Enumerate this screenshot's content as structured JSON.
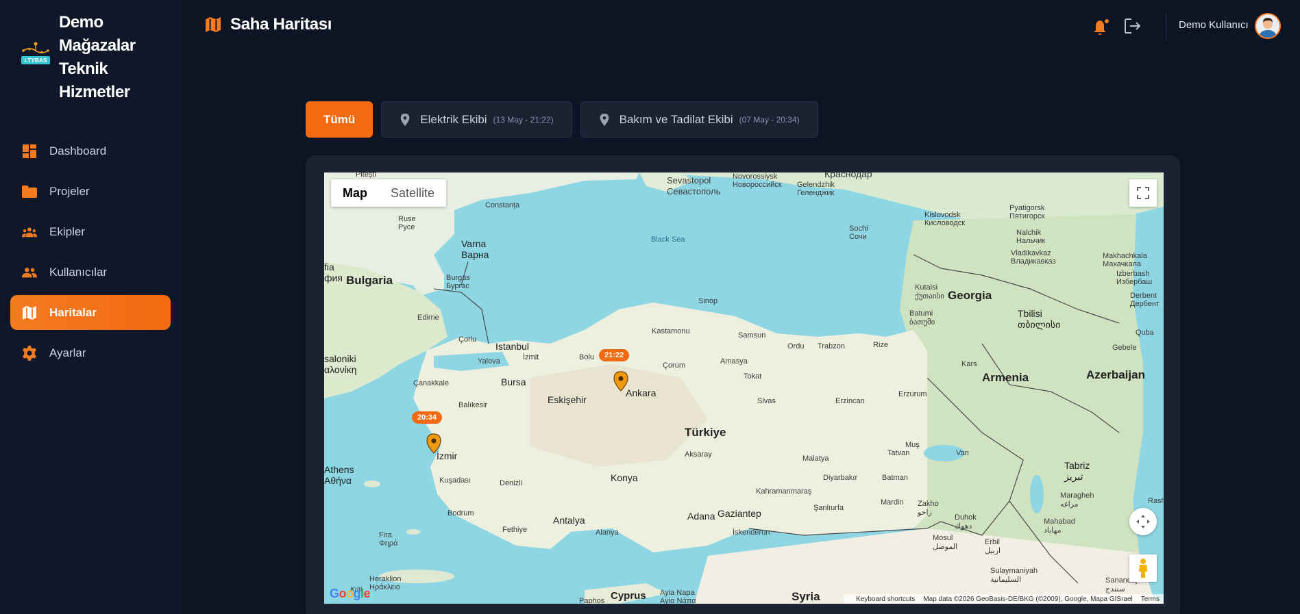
{
  "brand": {
    "name_lines": [
      "Demo",
      "Mağazalar",
      "Teknik",
      "Hizmetler"
    ],
    "logo_text": "LTYBAS"
  },
  "nav": [
    {
      "label": "Dashboard",
      "icon": "dashboard-icon"
    },
    {
      "label": "Projeler",
      "icon": "folder-icon"
    },
    {
      "label": "Ekipler",
      "icon": "team-icon"
    },
    {
      "label": "Kullanıcılar",
      "icon": "users-icon"
    },
    {
      "label": "Haritalar",
      "icon": "map-icon",
      "active": true
    },
    {
      "label": "Ayarlar",
      "icon": "gear-icon"
    }
  ],
  "header": {
    "title": "Saha Haritası",
    "user_name": "Demo Kullanıcı",
    "notification_dot": true
  },
  "filters": [
    {
      "label": "Tümü",
      "active": true
    },
    {
      "label": "Elektrik Ekibi",
      "meta": "(13 May - 21:22)"
    },
    {
      "label": "Bakım ve Tadilat Ekibi",
      "meta": "(07 May - 20:34)"
    }
  ],
  "map": {
    "type_options": [
      "Map",
      "Satellite"
    ],
    "selected_type": "Map",
    "markers": [
      {
        "time": "21:22",
        "city": "Ankara"
      },
      {
        "time": "20:34",
        "city": "İzmir"
      }
    ],
    "labels": {
      "sevastopol": "Sevastopol",
      "sevastopol_ru": "Севастополь",
      "novorossiysk": "Novorossiysk",
      "novorossiysk_ru": "Новороссийск",
      "gelendzhik": "Gelendzhik",
      "gelendzhik_ru": "Геленджик",
      "krasnodar": "Краснодар",
      "pitesti": "Pitești",
      "constanta": "Constanța",
      "ruse": "Ruse",
      "ruse_bg": "Русе",
      "varna": "Varna",
      "varna_bg": "Варна",
      "black_sea": "Black Sea",
      "sofia": "fia",
      "sofia_bg": "фия",
      "bulgaria": "Bulgaria",
      "burgas": "Burgas",
      "burgas_bg": "Бургас",
      "pyatigorsk": "Pyatigorsk",
      "pyatigorsk_ru": "Пятигорск",
      "kislovodsk": "Kislovodsk",
      "kislovodsk_ru": "Кисловодск",
      "sochi": "Sochi",
      "sochi_ru": "Сочи",
      "nalchik": "Nalchik",
      "nalchik_ru": "Нальчик",
      "vladikavkaz": "Vladikavkaz",
      "vladikavkaz_ru": "Владикавказ",
      "makhachkala": "Makhachkala",
      "makhachkala_ru": "Махачкала",
      "izberbash": "Izberbash",
      "izberbash_ru": "Избербаш",
      "derbent": "Derbent",
      "derbent_ru": "Дербент",
      "kutaisi": "Kutaisi",
      "kutaisi_ka": "ქუთაისი",
      "georgia": "Georgia",
      "tbilisi": "Tbilisi",
      "tbilisi_ka": "თბილისი",
      "batumi": "Batumi",
      "batumi_ka": "ბათუმი",
      "quba": "Quba",
      "sinop": "Sinop",
      "edirne": "Edirne",
      "kastamonu": "Kastamonu",
      "samsun": "Samsun",
      "ordu": "Ordu",
      "trabzon": "Trabzon",
      "rize": "Rize",
      "corlu": "Çorlu",
      "istanbul": "Istanbul",
      "izmit": "İzmit",
      "bolu": "Bolu",
      "yalova": "Yalova",
      "corum": "Çorum",
      "amasya": "Amasya",
      "thessaloniki": "saloniki",
      "thessaloniki_gr": "αλονίκη",
      "kars": "Kars",
      "gebele": "Gebele",
      "canakkale": "Çanakkale",
      "bursa": "Bursa",
      "tokat": "Tokat",
      "armenia": "Armenia",
      "azerbaijan": "Azerbaijan",
      "balikesir": "Balıkesir",
      "eskisehir": "Eskişehir",
      "ankara": "Ankara",
      "sivas": "Sivas",
      "erzincan": "Erzincan",
      "erzurum": "Erzurum",
      "turkiye": "Türkiye",
      "athens": "Athens",
      "athens_gr": "Αθήνα",
      "izmir": "İzmir",
      "aksaray": "Aksaray",
      "malatya": "Malatya",
      "mus": "Muş",
      "tatvan": "Tatvan",
      "van": "Van",
      "tabriz": "Tabriz",
      "tabriz_fa": "تبریز",
      "kusadasi": "Kuşadası",
      "denizli": "Denizli",
      "konya": "Konya",
      "diyarbakir": "Diyarbakır",
      "batman": "Batman",
      "kahramanmaras": "Kahramanmaraş",
      "maragheh": "Maragheh",
      "maragheh_fa": "مراغه",
      "bodrum": "Bodrum",
      "fethiye": "Fethiye",
      "antalya": "Antalya",
      "adana": "Adana",
      "gaziantep": "Gaziantep",
      "sanliurfa": "Şanlıurfa",
      "mardin": "Mardin",
      "zakho": "Zakho",
      "zakho_ar": "زاخو",
      "duhok": "Duhok",
      "duhok_ar": "دهوك",
      "mahabad": "Mahabad",
      "mahabad_fa": "مهاباد",
      "rash": "Rash",
      "alanya": "Alanya",
      "iskenderun": "İskenderun",
      "mosul": "Mosul",
      "mosul_ar": "الموصل",
      "erbil": "Erbil",
      "erbil_ar": "اربيل",
      "fira": "Fira",
      "fira_gr": "Φηρά",
      "sulaymaniyah": "Sulaymaniyah",
      "sulaymaniyah_ar": "السليمانية",
      "heraklion": "Heraklion",
      "heraklion_gr": "Ηράκλειο",
      "kriti": "Kriti",
      "sanandaj": "Sanandaj",
      "sanandaj_fa": "سنندج",
      "paphos": "Paphos",
      "cyprus": "Cyprus",
      "ayia_napa": "Ayia Napa",
      "ayia_napa_gr": "Αγία Νάπα",
      "syria": "Syria"
    },
    "footer": {
      "shortcuts": "Keyboard shortcuts",
      "attribution": "Map data ©2026 GeoBasis-DE/BKG (©2009), Google, Mapa GISrael",
      "terms": "Terms"
    },
    "google_logo": "Google"
  },
  "colors": {
    "accent": "#f26a12",
    "sidebar_bg": "#0f1729",
    "page_bg": "#0d1424",
    "card_bg": "#1b2231"
  }
}
